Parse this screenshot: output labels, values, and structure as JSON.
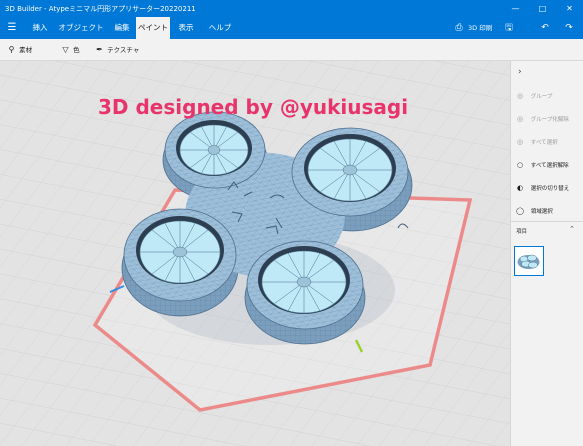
{
  "window": {
    "title": "3D Builder - Atypeミニマル円形アプリサーター20220211"
  },
  "ribbon": {
    "tabs": [
      {
        "label": "挿入"
      },
      {
        "label": "オブジェクト"
      },
      {
        "label": "編集"
      },
      {
        "label": "ペイント"
      },
      {
        "label": "表示"
      },
      {
        "label": "ヘルプ"
      }
    ],
    "active_tab": "ペイント",
    "print_label": "3D 印刷"
  },
  "toolbar": {
    "items": [
      {
        "label": "素材",
        "icon": "pin-icon"
      },
      {
        "label": "色",
        "icon": "bucket-icon"
      },
      {
        "label": "テクスチャ",
        "icon": "brush-icon"
      }
    ]
  },
  "panel": {
    "items": [
      {
        "label": "グループ",
        "enabled": false
      },
      {
        "label": "グループ化解除",
        "enabled": false
      },
      {
        "label": "すべて選択",
        "enabled": false
      },
      {
        "label": "すべて選択解除",
        "enabled": true
      },
      {
        "label": "選択の切り替え",
        "enabled": true
      },
      {
        "label": "領域選択",
        "enabled": true
      }
    ],
    "section_label": "項目"
  },
  "overlay": {
    "banner_text": "3D designed by @yukiusagi"
  },
  "colors": {
    "accent": "#0078d7",
    "model": "#8fb4d0",
    "model_wire": "#5d7f9d",
    "bowl": "#bfe9f7",
    "plate_outline": "#ec8a8a",
    "banner": "#e8336b"
  }
}
